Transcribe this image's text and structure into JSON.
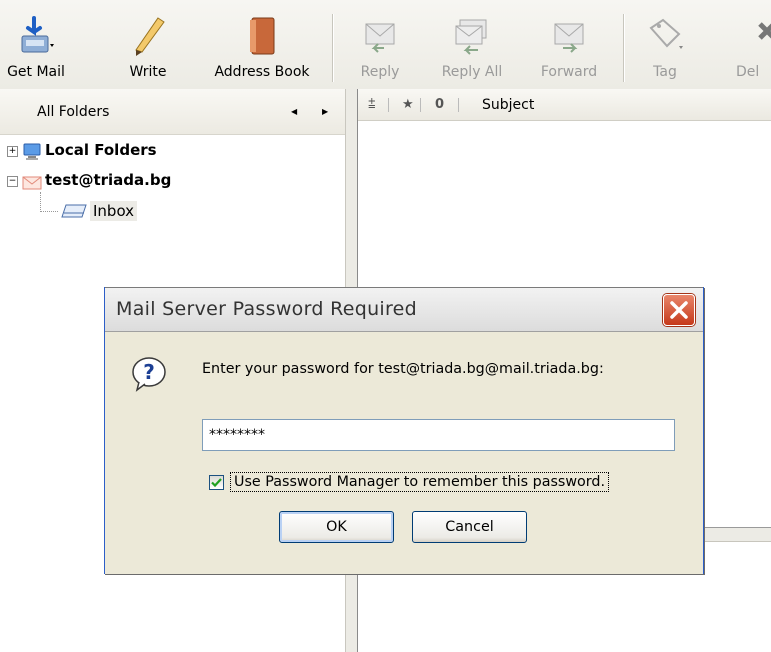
{
  "toolbar": {
    "get_mail": "Get Mail",
    "write": "Write",
    "address_book": "Address Book",
    "reply": "Reply",
    "reply_all": "Reply All",
    "forward": "Forward",
    "tag": "Tag",
    "delete_partial": "Del"
  },
  "folder_pane": {
    "header": "All Folders",
    "items": [
      {
        "label": "Local Folders",
        "expanded": false
      },
      {
        "label": "test@triada.bg",
        "expanded": true
      },
      {
        "label": "Inbox"
      }
    ]
  },
  "thread_pane": {
    "subject_col": "Subject"
  },
  "dialog": {
    "title": "Mail Server Password Required",
    "prompt": "Enter your password for test@triada.bg@mail.triada.bg:",
    "password_value": "********",
    "checkbox_label": "Use Password Manager to remember this password.",
    "checkbox_checked": true,
    "ok": "OK",
    "cancel": "Cancel"
  },
  "colors": {
    "toolbar_bg": "#ecebe4",
    "dialog_bg": "#ece9d8",
    "close_btn": "#c5391b",
    "xp_border": "#003c74"
  }
}
